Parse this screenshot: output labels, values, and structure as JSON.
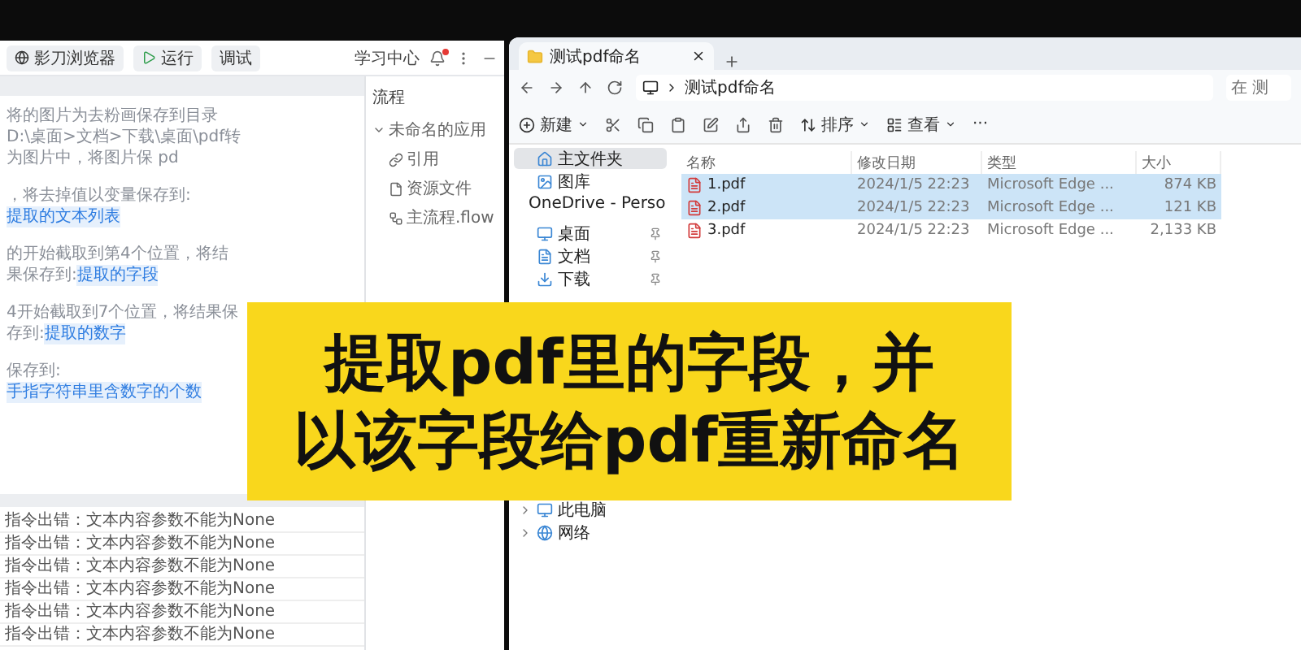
{
  "app": {
    "toolbar": {
      "browser_button": "影刀浏览器",
      "run_button": "运行",
      "debug_button": "调试",
      "learning_center": "学习中心",
      "has_notification": true
    },
    "editor_lines": [
      {
        "text": "将的图片为去粉画保存到目录D:\\桌面>文档>下载\\桌面\\pdf转为图片中，将图片保 pd"
      },
      {
        "text": "，将去掉值以变量保存到:",
        "link": "提取的文本列表"
      },
      {
        "text": "的开始截取到第4个位置，将结果保存到:",
        "link": "提取的字段"
      },
      {
        "text": "4开始截取到7个位置，将结果保存到:",
        "link": "提取的数字"
      },
      {
        "text": "保存到:",
        "link": "手指字符串里含数字的个数"
      }
    ],
    "log_rows": [
      "指令出错：文本内容参数不能为None",
      "指令出错：文本内容参数不能为None",
      "指令出错：文本内容参数不能为None",
      "指令出错：文本内容参数不能为None",
      "指令出错：文本内容参数不能为None",
      "指令出错：文本内容参数不能为None"
    ],
    "flow_panel": {
      "title": "流程",
      "tree": [
        {
          "label": "未命名的应用",
          "expanded": true,
          "children": [
            {
              "label": "引用",
              "kind": "reference"
            },
            {
              "label": "资源文件",
              "kind": "file"
            },
            {
              "label": "主流程.flow",
              "kind": "flow"
            }
          ]
        }
      ]
    }
  },
  "explorer": {
    "tab": {
      "title": "测试pdf命名"
    },
    "address": "测试pdf命名",
    "search": {
      "placeholder": "在 测"
    },
    "toolbar": {
      "new_button": "新建",
      "sort_button": "排序",
      "view_button": "查看",
      "more_button": "···"
    },
    "nav": [
      {
        "label": "主文件夹",
        "kind": "home",
        "selected": true
      },
      {
        "label": "图库",
        "kind": "gallery",
        "selected": false
      },
      {
        "label": "OneDrive - Perso",
        "kind": "cloud",
        "selected": false
      },
      {
        "label": "桌面",
        "kind": "desktop",
        "selected": false
      },
      {
        "label": "文档",
        "kind": "documents",
        "selected": false
      },
      {
        "label": "下载",
        "kind": "downloads",
        "selected": false
      },
      {
        "label": "此电脑",
        "kind": "pc",
        "selected": false
      },
      {
        "label": "网络",
        "kind": "network",
        "selected": false
      }
    ],
    "columns": [
      "名称",
      "修改日期",
      "类型",
      "大小"
    ],
    "files": [
      {
        "name": "1.pdf",
        "modified": "2024/1/5 22:23",
        "type": "Microsoft Edge ...",
        "size": "874 KB",
        "selected": true
      },
      {
        "name": "2.pdf",
        "modified": "2024/1/5 22:23",
        "type": "Microsoft Edge ...",
        "size": "121 KB",
        "selected": true
      },
      {
        "name": "3.pdf",
        "modified": "2024/1/5 22:23",
        "type": "Microsoft Edge ...",
        "size": "2,133 KB",
        "selected": false
      }
    ]
  },
  "banner": {
    "lines": [
      "提取pdf里的字段，并",
      "以该字段给pdf重新命名"
    ]
  }
}
